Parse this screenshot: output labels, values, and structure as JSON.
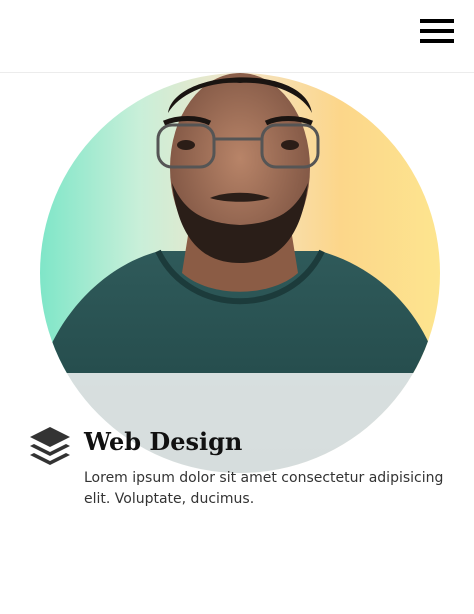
{
  "header": {
    "menu_icon": "hamburger-menu-icon"
  },
  "card": {
    "image_icon": "person-photo",
    "service_icon": "layers-icon",
    "title": "Web Design",
    "description": "Lorem ipsum dolor sit amet consectetur adipisicing elit. Voluptate, ducimus."
  }
}
